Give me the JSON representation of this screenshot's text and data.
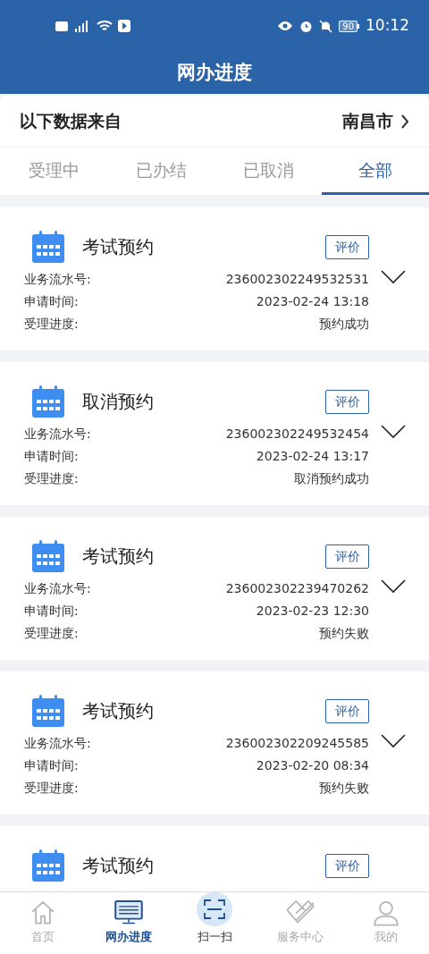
{
  "status_bar": {
    "time": "10:12",
    "battery": "90"
  },
  "header": {
    "title": "网办进度"
  },
  "region": {
    "label": "以下数据来自",
    "city": "南昌市"
  },
  "tabs": [
    {
      "label": "受理中",
      "selected": false
    },
    {
      "label": "已办结",
      "selected": false
    },
    {
      "label": "已取消",
      "selected": false
    },
    {
      "label": "全部",
      "selected": true
    }
  ],
  "records": [
    {
      "title": "考试预约",
      "button": "评价",
      "fields": [
        {
          "label": "业务流水号:",
          "value": "236002302249532531"
        },
        {
          "label": "申请时间:",
          "value": "2023-02-24 13:18"
        },
        {
          "label": "受理进度:",
          "value": "预约成功"
        }
      ]
    },
    {
      "title": "取消预约",
      "button": "评价",
      "fields": [
        {
          "label": "业务流水号:",
          "value": "236002302249532454"
        },
        {
          "label": "申请时间:",
          "value": "2023-02-24 13:17"
        },
        {
          "label": "受理进度:",
          "value": "取消预约成功"
        }
      ]
    },
    {
      "title": "考试预约",
      "button": "评价",
      "fields": [
        {
          "label": "业务流水号:",
          "value": "236002302239470262"
        },
        {
          "label": "申请时间:",
          "value": "2023-02-23 12:30"
        },
        {
          "label": "受理进度:",
          "value": "预约失败"
        }
      ]
    },
    {
      "title": "考试预约",
      "button": "评价",
      "fields": [
        {
          "label": "业务流水号:",
          "value": "236002302209245585"
        },
        {
          "label": "申请时间:",
          "value": "2023-02-20 08:34"
        },
        {
          "label": "受理进度:",
          "value": "预约失败"
        }
      ]
    },
    {
      "title": "考试预约",
      "button": "评价"
    }
  ],
  "bottom_nav": [
    {
      "label": "首页",
      "kind": "home",
      "selected": false
    },
    {
      "label": "网办进度",
      "kind": "progress",
      "selected": true
    },
    {
      "label": "扫一扫",
      "kind": "scan",
      "selected": false
    },
    {
      "label": "服务中心",
      "kind": "service",
      "selected": false
    },
    {
      "label": "我的",
      "kind": "profile",
      "selected": false
    }
  ]
}
